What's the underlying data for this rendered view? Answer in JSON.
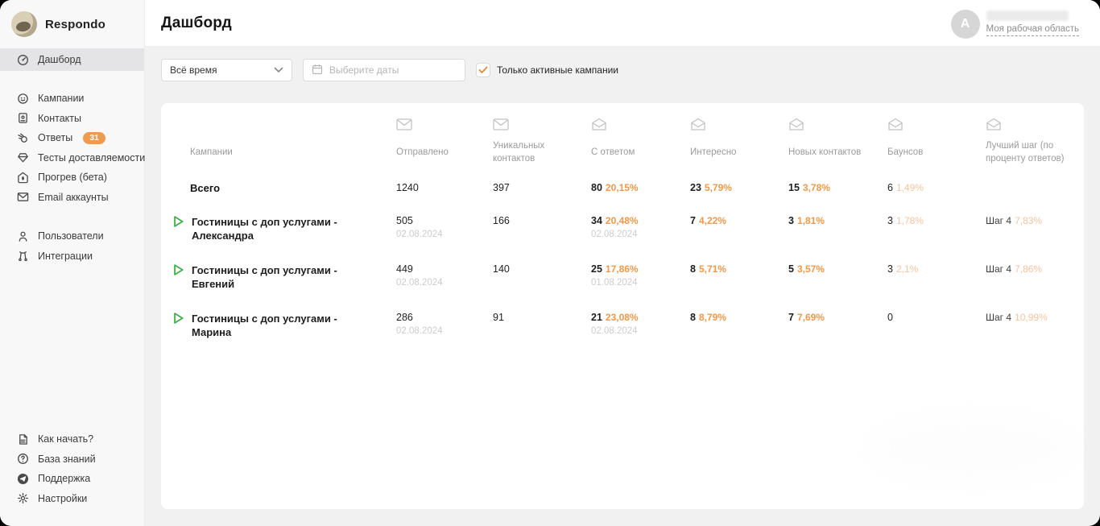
{
  "app": {
    "brand": "Respondo"
  },
  "colors": {
    "accent_orange": "#F2984A",
    "pale_orange": "#F6C39D",
    "green_play": "#3CB14A",
    "badge_orange": "#F09A4E"
  },
  "sidebar": {
    "main": [
      {
        "label": "Дашборд"
      }
    ],
    "group2": [
      {
        "label": "Кампании"
      },
      {
        "label": "Контакты"
      },
      {
        "label": "Ответы",
        "badge": "31"
      },
      {
        "label": "Тесты доставляемости"
      },
      {
        "label": "Прогрев (бета)"
      },
      {
        "label": "Email аккаунты"
      }
    ],
    "group3": [
      {
        "label": "Пользователи"
      },
      {
        "label": "Интеграции"
      }
    ],
    "bottom": [
      {
        "label": "Как начать?"
      },
      {
        "label": "База знаний"
      },
      {
        "label": "Поддержка"
      },
      {
        "label": "Настройки"
      }
    ]
  },
  "header": {
    "title": "Дашборд",
    "avatar_letter": "A",
    "workspace_label": "Моя рабочая область"
  },
  "filters": {
    "period_value": "Всё время",
    "date_placeholder": "Выберите даты",
    "checkbox_label": "Только активные кампании",
    "checkbox_checked": true
  },
  "table": {
    "columns": {
      "campaigns": "Кампании",
      "sent": "Отправлено",
      "unique_contacts": "Уникальных контактов",
      "replied": "С ответом",
      "interested": "Интересно",
      "new_contacts": "Новых контактов",
      "bounces": "Баунсов",
      "best_step": "Лучший шаг (по проценту ответов)"
    },
    "totals": {
      "name": "Всего",
      "sent": "1240",
      "unique": "397",
      "replied_count": "80",
      "replied_pct": "20,15%",
      "interested_count": "23",
      "interested_pct": "5,79%",
      "new_count": "15",
      "new_pct": "3,78%",
      "bounce_count": "6",
      "bounce_pct": "1,49%"
    },
    "rows": [
      {
        "name": "Гостиницы с доп услугами - Александра",
        "sent": "505",
        "sent_date": "02.08.2024",
        "unique": "166",
        "replied_count": "34",
        "replied_pct": "20,48%",
        "replied_date": "02.08.2024",
        "interested_count": "7",
        "interested_pct": "4,22%",
        "new_count": "3",
        "new_pct": "1,81%",
        "bounce_count": "3",
        "bounce_pct": "1,78%",
        "best_step": "Шаг 4",
        "best_step_pct": "7,83%"
      },
      {
        "name": "Гостиницы с доп услугами - Евгений",
        "sent": "449",
        "sent_date": "02.08.2024",
        "unique": "140",
        "replied_count": "25",
        "replied_pct": "17,86%",
        "replied_date": "01.08.2024",
        "interested_count": "8",
        "interested_pct": "5,71%",
        "new_count": "5",
        "new_pct": "3,57%",
        "bounce_count": "3",
        "bounce_pct": "2,1%",
        "best_step": "Шаг 4",
        "best_step_pct": "7,86%"
      },
      {
        "name": "Гостиницы с доп услугами - Марина",
        "sent": "286",
        "sent_date": "02.08.2024",
        "unique": "91",
        "replied_count": "21",
        "replied_pct": "23,08%",
        "replied_date": "02.08.2024",
        "interested_count": "8",
        "interested_pct": "8,79%",
        "new_count": "7",
        "new_pct": "7,69%",
        "bounce_count": "0",
        "best_step": "Шаг 4",
        "best_step_pct": "10,99%"
      }
    ]
  }
}
